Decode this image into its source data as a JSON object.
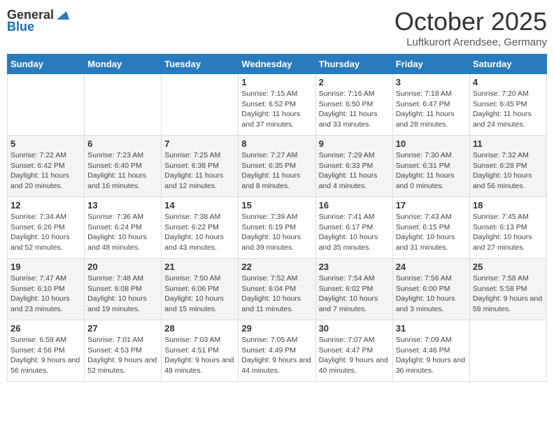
{
  "header": {
    "logo_general": "General",
    "logo_blue": "Blue",
    "month": "October 2025",
    "location": "Luftkurort Arendsee, Germany"
  },
  "days_of_week": [
    "Sunday",
    "Monday",
    "Tuesday",
    "Wednesday",
    "Thursday",
    "Friday",
    "Saturday"
  ],
  "weeks": [
    [
      {
        "day": "",
        "info": ""
      },
      {
        "day": "",
        "info": ""
      },
      {
        "day": "",
        "info": ""
      },
      {
        "day": "1",
        "info": "Sunrise: 7:15 AM\nSunset: 6:52 PM\nDaylight: 11 hours and 37 minutes."
      },
      {
        "day": "2",
        "info": "Sunrise: 7:16 AM\nSunset: 6:50 PM\nDaylight: 11 hours and 33 minutes."
      },
      {
        "day": "3",
        "info": "Sunrise: 7:18 AM\nSunset: 6:47 PM\nDaylight: 11 hours and 28 minutes."
      },
      {
        "day": "4",
        "info": "Sunrise: 7:20 AM\nSunset: 6:45 PM\nDaylight: 11 hours and 24 minutes."
      }
    ],
    [
      {
        "day": "5",
        "info": "Sunrise: 7:22 AM\nSunset: 6:42 PM\nDaylight: 11 hours and 20 minutes."
      },
      {
        "day": "6",
        "info": "Sunrise: 7:23 AM\nSunset: 6:40 PM\nDaylight: 11 hours and 16 minutes."
      },
      {
        "day": "7",
        "info": "Sunrise: 7:25 AM\nSunset: 6:38 PM\nDaylight: 11 hours and 12 minutes."
      },
      {
        "day": "8",
        "info": "Sunrise: 7:27 AM\nSunset: 6:35 PM\nDaylight: 11 hours and 8 minutes."
      },
      {
        "day": "9",
        "info": "Sunrise: 7:29 AM\nSunset: 6:33 PM\nDaylight: 11 hours and 4 minutes."
      },
      {
        "day": "10",
        "info": "Sunrise: 7:30 AM\nSunset: 6:31 PM\nDaylight: 11 hours and 0 minutes."
      },
      {
        "day": "11",
        "info": "Sunrise: 7:32 AM\nSunset: 6:28 PM\nDaylight: 10 hours and 56 minutes."
      }
    ],
    [
      {
        "day": "12",
        "info": "Sunrise: 7:34 AM\nSunset: 6:26 PM\nDaylight: 10 hours and 52 minutes."
      },
      {
        "day": "13",
        "info": "Sunrise: 7:36 AM\nSunset: 6:24 PM\nDaylight: 10 hours and 48 minutes."
      },
      {
        "day": "14",
        "info": "Sunrise: 7:38 AM\nSunset: 6:22 PM\nDaylight: 10 hours and 43 minutes."
      },
      {
        "day": "15",
        "info": "Sunrise: 7:39 AM\nSunset: 6:19 PM\nDaylight: 10 hours and 39 minutes."
      },
      {
        "day": "16",
        "info": "Sunrise: 7:41 AM\nSunset: 6:17 PM\nDaylight: 10 hours and 35 minutes."
      },
      {
        "day": "17",
        "info": "Sunrise: 7:43 AM\nSunset: 6:15 PM\nDaylight: 10 hours and 31 minutes."
      },
      {
        "day": "18",
        "info": "Sunrise: 7:45 AM\nSunset: 6:13 PM\nDaylight: 10 hours and 27 minutes."
      }
    ],
    [
      {
        "day": "19",
        "info": "Sunrise: 7:47 AM\nSunset: 6:10 PM\nDaylight: 10 hours and 23 minutes."
      },
      {
        "day": "20",
        "info": "Sunrise: 7:48 AM\nSunset: 6:08 PM\nDaylight: 10 hours and 19 minutes."
      },
      {
        "day": "21",
        "info": "Sunrise: 7:50 AM\nSunset: 6:06 PM\nDaylight: 10 hours and 15 minutes."
      },
      {
        "day": "22",
        "info": "Sunrise: 7:52 AM\nSunset: 6:04 PM\nDaylight: 10 hours and 11 minutes."
      },
      {
        "day": "23",
        "info": "Sunrise: 7:54 AM\nSunset: 6:02 PM\nDaylight: 10 hours and 7 minutes."
      },
      {
        "day": "24",
        "info": "Sunrise: 7:56 AM\nSunset: 6:00 PM\nDaylight: 10 hours and 3 minutes."
      },
      {
        "day": "25",
        "info": "Sunrise: 7:58 AM\nSunset: 5:58 PM\nDaylight: 9 hours and 59 minutes."
      }
    ],
    [
      {
        "day": "26",
        "info": "Sunrise: 6:59 AM\nSunset: 4:56 PM\nDaylight: 9 hours and 56 minutes."
      },
      {
        "day": "27",
        "info": "Sunrise: 7:01 AM\nSunset: 4:53 PM\nDaylight: 9 hours and 52 minutes."
      },
      {
        "day": "28",
        "info": "Sunrise: 7:03 AM\nSunset: 4:51 PM\nDaylight: 9 hours and 48 minutes."
      },
      {
        "day": "29",
        "info": "Sunrise: 7:05 AM\nSunset: 4:49 PM\nDaylight: 9 hours and 44 minutes."
      },
      {
        "day": "30",
        "info": "Sunrise: 7:07 AM\nSunset: 4:47 PM\nDaylight: 9 hours and 40 minutes."
      },
      {
        "day": "31",
        "info": "Sunrise: 7:09 AM\nSunset: 4:46 PM\nDaylight: 9 hours and 36 minutes."
      },
      {
        "day": "",
        "info": ""
      }
    ]
  ]
}
